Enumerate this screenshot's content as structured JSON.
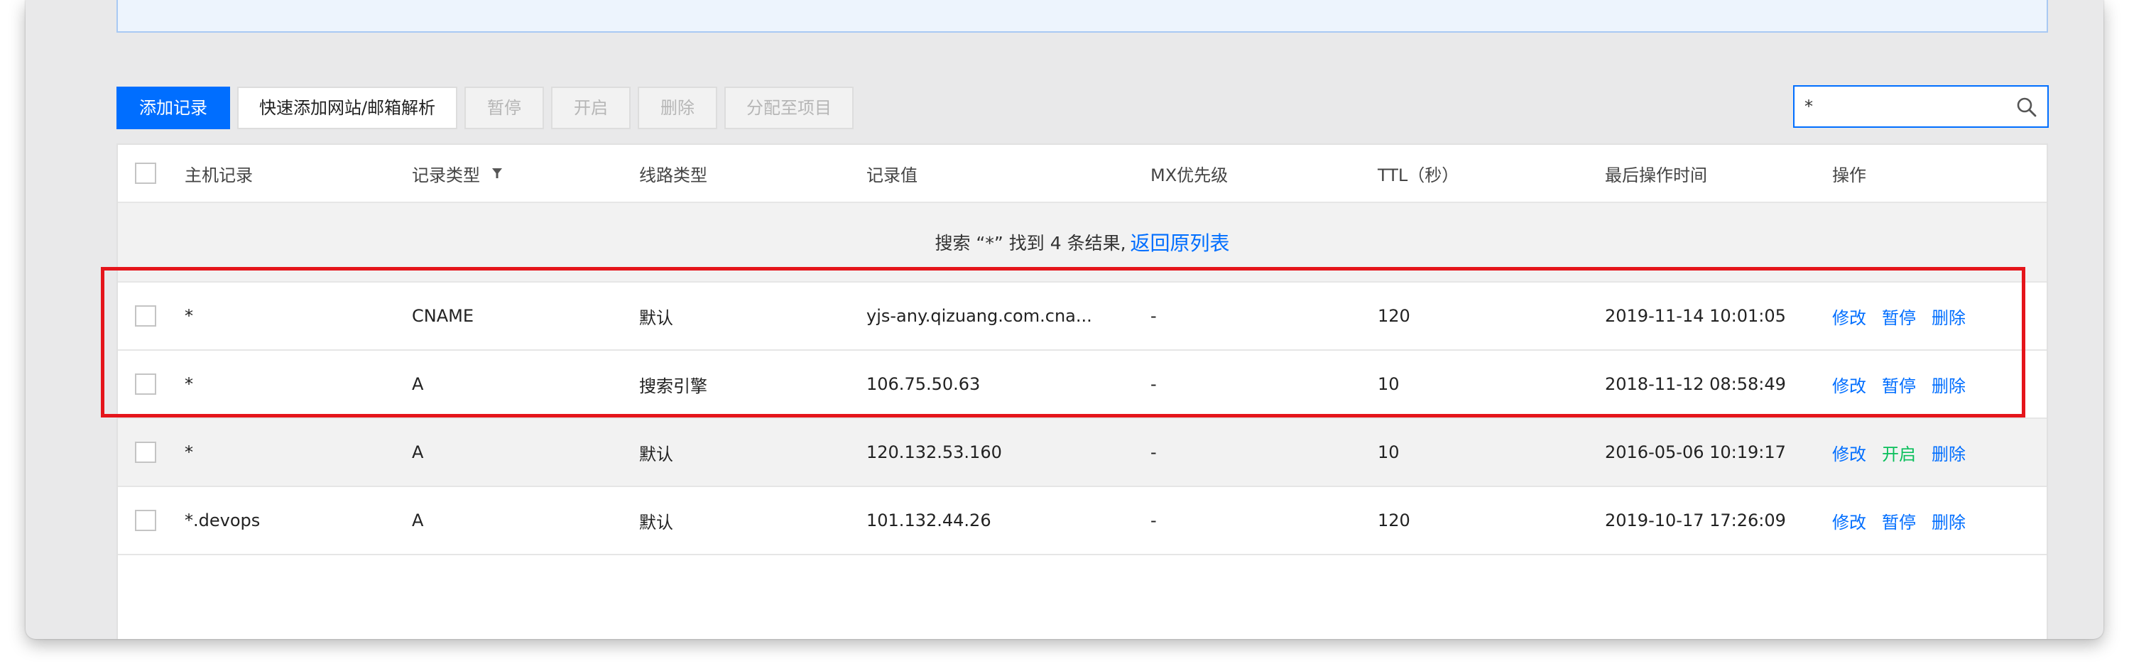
{
  "toolbar": {
    "add_record": "添加记录",
    "quick_add": "快速添加网站/邮箱解析",
    "pause": "暂停",
    "enable": "开启",
    "delete": "删除",
    "assign_project": "分配至项目"
  },
  "search": {
    "value": "*"
  },
  "table": {
    "headers": {
      "host": "主机记录",
      "type": "记录类型",
      "line": "线路类型",
      "value": "记录值",
      "mx": "MX优先级",
      "ttl": "TTL（秒）",
      "last_modified": "最后操作时间",
      "actions": "操作"
    },
    "search_result": {
      "text": "搜索 “*” 找到 4 条结果,",
      "back_link": "返回原列表"
    },
    "rows": [
      {
        "host": "*",
        "type": "CNAME",
        "line": "默认",
        "value": "yjs-any.qizuang.com.cna...",
        "mx": "-",
        "ttl": "120",
        "time": "2019-11-14 10:01:05",
        "op_edit": "修改",
        "op_toggle": "暂停",
        "op_delete": "删除"
      },
      {
        "host": "*",
        "type": "A",
        "line": "搜索引擎",
        "value": "106.75.50.63",
        "mx": "-",
        "ttl": "10",
        "time": "2018-11-12 08:58:49",
        "op_edit": "修改",
        "op_toggle": "暂停",
        "op_delete": "删除"
      },
      {
        "host": "*",
        "type": "A",
        "line": "默认",
        "value": "120.132.53.160",
        "mx": "-",
        "ttl": "10",
        "time": "2016-05-06 10:19:17",
        "op_edit": "修改",
        "op_toggle": "开启",
        "op_delete": "删除"
      },
      {
        "host": "*.devops",
        "type": "A",
        "line": "默认",
        "value": "101.132.44.26",
        "mx": "-",
        "ttl": "120",
        "time": "2019-10-17 17:26:09",
        "op_edit": "修改",
        "op_toggle": "暂停",
        "op_delete": "删除"
      }
    ]
  },
  "colors": {
    "accent": "#006eff",
    "enable_green": "#0abf5b",
    "highlight_red": "#e5151b"
  }
}
